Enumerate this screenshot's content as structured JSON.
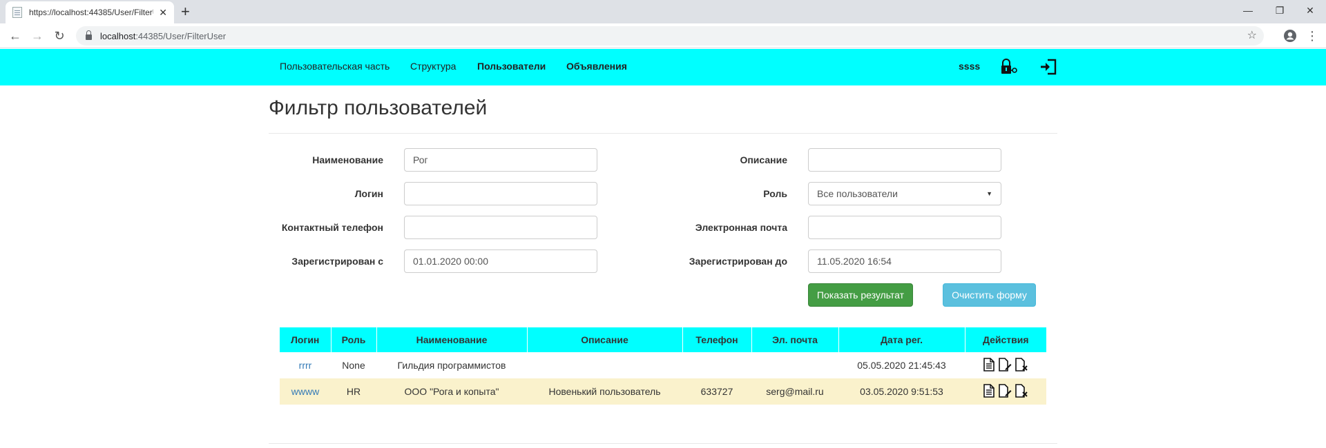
{
  "browser": {
    "tab_title": "https://localhost:44385/User/FilterUser",
    "url_host": "localhost",
    "url_path": ":44385/User/FilterUser"
  },
  "nav": {
    "links": [
      "Пользовательская часть",
      "Структура",
      "Пользователи",
      "Объявления"
    ],
    "username": "ssss"
  },
  "page": {
    "title": "Фильтр пользователей"
  },
  "filter": {
    "name_label": "Наименование",
    "name_value": "Рог",
    "login_label": "Логин",
    "login_value": "",
    "phone_label": "Контактный телефон",
    "phone_value": "",
    "reg_from_label": "Зарегистрирован с",
    "reg_from_value": "01.01.2020 00:00",
    "desc_label": "Описание",
    "desc_value": "",
    "role_label": "Роль",
    "role_selected": "Все пользователи",
    "email_label": "Электронная почта",
    "email_value": "",
    "reg_to_label": "Зарегистрирован до",
    "reg_to_value": "11.05.2020 16:54",
    "show_button": "Показать результат",
    "clear_button": "Очистить форму"
  },
  "table": {
    "columns": [
      "Логин",
      "Роль",
      "Наименование",
      "Описание",
      "Телефон",
      "Эл. почта",
      "Дата рег.",
      "Действия"
    ],
    "rows": [
      [
        "rrrr",
        "None",
        "Гильдия программистов",
        "",
        "",
        "",
        "05.05.2020 21:45:43"
      ],
      [
        "wwww",
        "HR",
        "ООО \"Рога и копыта\"",
        "Новенький пользователь",
        "633727",
        "serg@mail.ru",
        "03.05.2020 9:51:53"
      ]
    ]
  },
  "colors": {
    "accent": "#00ffff",
    "success": "#449d44",
    "info": "#5bc0de",
    "row_highlight": "#faf2cc",
    "link": "#337ab7"
  }
}
